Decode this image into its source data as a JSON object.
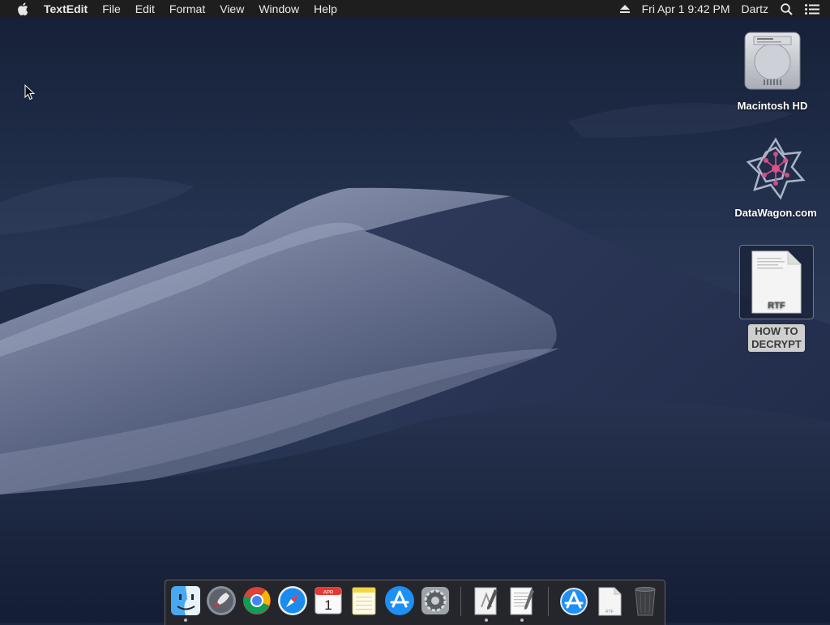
{
  "menubar": {
    "app_name": "TextEdit",
    "menus": [
      "File",
      "Edit",
      "Format",
      "View",
      "Window",
      "Help"
    ],
    "clock": "Fri Apr 1  9:42 PM",
    "user": "Dartz"
  },
  "desktop": {
    "icons": [
      {
        "label": "Macintosh HD",
        "icon": "hard-drive-icon"
      },
      {
        "label": "DataWagon.com",
        "icon": "datawagon-logo-icon"
      },
      {
        "label": "HOW TO DECRYPT",
        "icon": "rtf-document-icon",
        "badge": "RTF",
        "selected": true
      }
    ]
  },
  "dock": {
    "apps": [
      {
        "name": "Finder",
        "icon": "finder-icon",
        "running": true
      },
      {
        "name": "Launchpad",
        "icon": "launchpad-icon",
        "running": false
      },
      {
        "name": "Google Chrome",
        "icon": "chrome-icon",
        "running": false
      },
      {
        "name": "Safari",
        "icon": "safari-icon",
        "running": false
      },
      {
        "name": "Calendar",
        "icon": "calendar-icon",
        "running": false,
        "month": "APR",
        "day": "1"
      },
      {
        "name": "Notes",
        "icon": "notes-icon",
        "running": false
      },
      {
        "name": "App Store",
        "icon": "app-store-icon",
        "running": false
      },
      {
        "name": "System Preferences",
        "icon": "system-preferences-icon",
        "running": false
      },
      {
        "name": "Script Editor",
        "icon": "script-editor-icon",
        "running": true
      },
      {
        "name": "TextEdit",
        "icon": "textedit-icon",
        "running": true
      },
      {
        "name": "Applications",
        "icon": "applications-folder-icon",
        "running": false
      },
      {
        "name": "HOW TO DECRYPT",
        "icon": "rtf-file-icon",
        "running": false,
        "badge": "RTF"
      },
      {
        "name": "Trash",
        "icon": "trash-icon",
        "running": false
      }
    ]
  },
  "colors": {
    "menubar_bg": "#1e1e1e",
    "sky_top": "#17223a",
    "dune_light": "#8f99b4",
    "accent_blue": "#1a8cf0"
  }
}
